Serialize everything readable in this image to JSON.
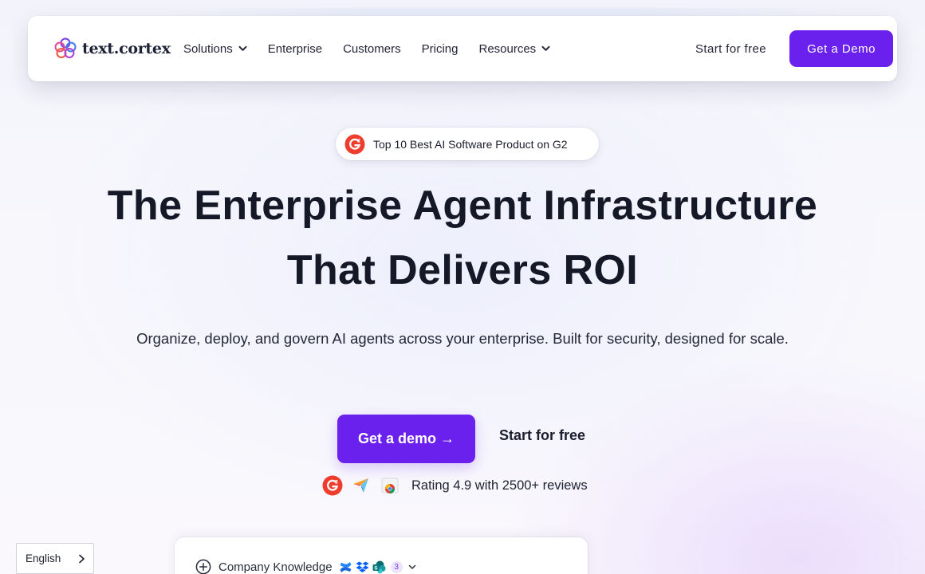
{
  "brand": {
    "logo_text": "text.cortex",
    "accent": "#6b21ee",
    "logo_colors": [
      "#e24a8b",
      "#7a3df0",
      "#f0573b",
      "#3f7ce6"
    ]
  },
  "nav": {
    "items": [
      {
        "label": "Solutions",
        "has_dropdown": true
      },
      {
        "label": "Enterprise",
        "has_dropdown": false
      },
      {
        "label": "Customers",
        "has_dropdown": false
      },
      {
        "label": "Pricing",
        "has_dropdown": false
      },
      {
        "label": "Resources",
        "has_dropdown": true
      }
    ],
    "start_label": "Start for free",
    "demo_label": "Get a Demo"
  },
  "badge": {
    "icon": "g2-icon",
    "text": "Top 10 Best AI Software Product on G2"
  },
  "hero": {
    "headline_line1": "The Enterprise Agent Infrastructure",
    "headline_line2": "That Delivers ROI",
    "subtext": "Organize, deploy, and govern AI agents across your enterprise. Built for security, designed for scale.",
    "cta_demo": "Get a demo →",
    "cta_start": "Start for free"
  },
  "rating": {
    "icons": [
      "g2-icon",
      "capterra-icon",
      "chrome-store-icon"
    ],
    "text": "Rating 4.9 with 2500+ reviews"
  },
  "language": {
    "selected": "English"
  },
  "knowledge_card": {
    "label": "Company Knowledge",
    "integrations": [
      "confluence-icon",
      "dropbox-icon",
      "sharepoint-icon"
    ],
    "extra_count": "3"
  }
}
